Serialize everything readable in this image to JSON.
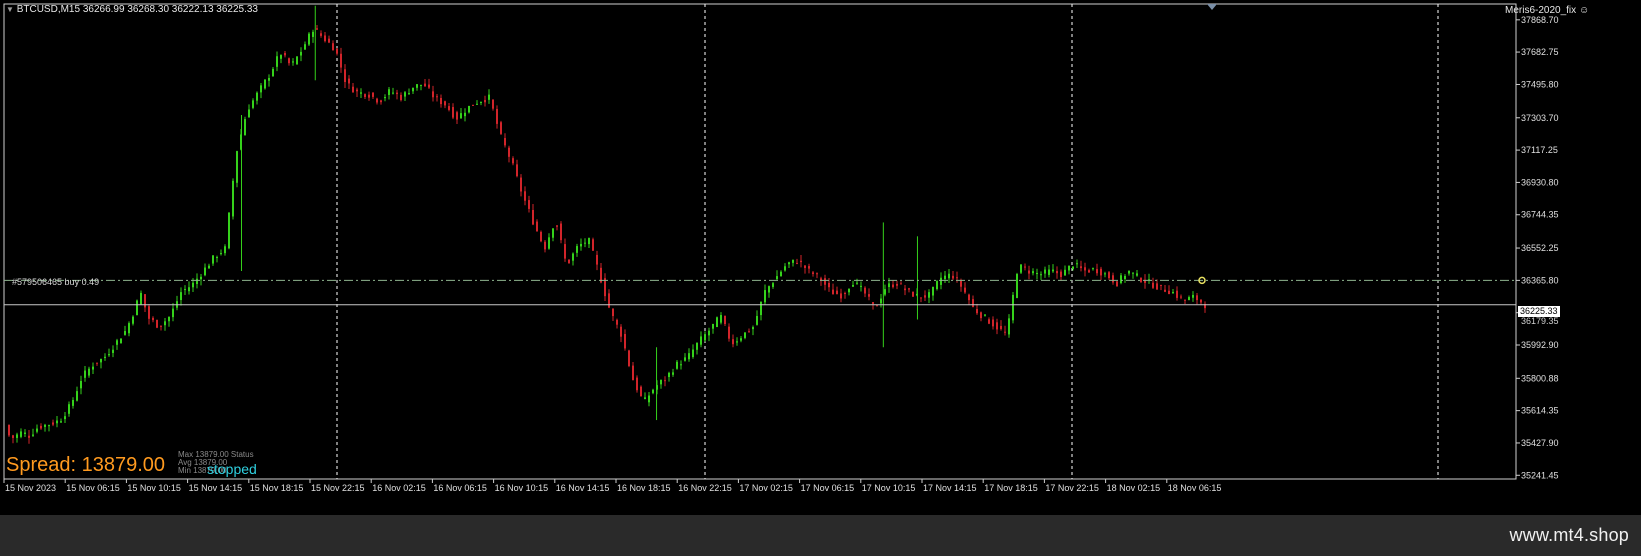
{
  "header": {
    "symbol_info": "BTCUSD,M15  36266.99 36268.30 36222.13 36225.33",
    "indicator_name": "Meris6-2020_fix"
  },
  "chart_data": {
    "type": "candlestick",
    "symbol": "BTCUSD",
    "timeframe": "M15",
    "ohlc": {
      "open": 36266.99,
      "high": 36268.3,
      "low": 36222.13,
      "close": 36225.33
    },
    "y_ticks": [
      "37868.70",
      "37682.75",
      "37495.80",
      "37303.70",
      "37117.25",
      "36930.80",
      "36744.35",
      "36552.25",
      "36365.80",
      "36179.35",
      "35992.90",
      "35800.88",
      "35614.35",
      "35427.90",
      "35241.45"
    ],
    "y_tick_values": [
      37868.7,
      37682.75,
      37495.8,
      37303.7,
      37117.25,
      36930.8,
      36744.35,
      36552.25,
      36365.8,
      36179.35,
      35992.9,
      35800.88,
      35614.35,
      35427.9,
      35241.45
    ],
    "ylim": [
      35220,
      37960
    ],
    "x_ticks": [
      "15 Nov 2023",
      "15 Nov 06:15",
      "15 Nov 10:15",
      "15 Nov 14:15",
      "15 Nov 18:15",
      "15 Nov 22:15",
      "16 Nov 02:15",
      "16 Nov 06:15",
      "16 Nov 10:15",
      "16 Nov 14:15",
      "16 Nov 18:15",
      "16 Nov 22:15",
      "17 Nov 02:15",
      "17 Nov 06:15",
      "17 Nov 10:15",
      "17 Nov 14:15",
      "17 Nov 18:15",
      "17 Nov 22:15",
      "18 Nov 02:15",
      "18 Nov 06:15"
    ],
    "current_price": "36225.33",
    "price_below_tag": "36179.35",
    "order_line": {
      "label": "#579506465 buy 0.49",
      "price": 36365.8
    },
    "path_points": [
      [
        0,
        35530
      ],
      [
        0.5,
        35450
      ],
      [
        1.5,
        35490
      ],
      [
        2.2,
        35470
      ],
      [
        3.0,
        35520
      ],
      [
        4.2,
        35540
      ],
      [
        5.0,
        35560
      ],
      [
        6.0,
        35650
      ],
      [
        7.0,
        35810
      ],
      [
        8.0,
        35880
      ],
      [
        9.0,
        35920
      ],
      [
        10.0,
        36000
      ],
      [
        11.0,
        36080
      ],
      [
        11.8,
        36200
      ],
      [
        12.3,
        36300
      ],
      [
        13.0,
        36150
      ],
      [
        14.0,
        36100
      ],
      [
        15.0,
        36160
      ],
      [
        16.0,
        36300
      ],
      [
        17.0,
        36340
      ],
      [
        18.0,
        36420
      ],
      [
        19.0,
        36500
      ],
      [
        20.0,
        36550
      ],
      [
        21.0,
        37100
      ],
      [
        22.0,
        37350
      ],
      [
        23.0,
        37450
      ],
      [
        24.0,
        37550
      ],
      [
        25.0,
        37680
      ],
      [
        26.0,
        37600
      ],
      [
        27.0,
        37700
      ],
      [
        28.0,
        37820
      ],
      [
        29.0,
        37760
      ],
      [
        30.0,
        37700
      ],
      [
        31.0,
        37500
      ],
      [
        32.0,
        37450
      ],
      [
        33.0,
        37440
      ],
      [
        34.0,
        37400
      ],
      [
        35.0,
        37460
      ],
      [
        36.0,
        37420
      ],
      [
        37.0,
        37480
      ],
      [
        38.0,
        37500
      ],
      [
        39.0,
        37420
      ],
      [
        40.0,
        37380
      ],
      [
        41.0,
        37300
      ],
      [
        42.0,
        37360
      ],
      [
        43.0,
        37400
      ],
      [
        44.0,
        37420
      ],
      [
        45.0,
        37200
      ],
      [
        46.0,
        37050
      ],
      [
        47.0,
        36860
      ],
      [
        48.0,
        36700
      ],
      [
        49.0,
        36550
      ],
      [
        50.0,
        36720
      ],
      [
        51.0,
        36450
      ],
      [
        52.0,
        36560
      ],
      [
        53.0,
        36600
      ],
      [
        54.0,
        36400
      ],
      [
        55.0,
        36180
      ],
      [
        56.0,
        36050
      ],
      [
        57.0,
        35800
      ],
      [
        58.0,
        35660
      ],
      [
        59.0,
        35750
      ],
      [
        60.0,
        35800
      ],
      [
        61.0,
        35880
      ],
      [
        62.0,
        35920
      ],
      [
        63.0,
        36010
      ],
      [
        64.0,
        36080
      ],
      [
        65.0,
        36160
      ],
      [
        66.0,
        36000
      ],
      [
        67.0,
        36050
      ],
      [
        68.0,
        36100
      ],
      [
        69.0,
        36300
      ],
      [
        70.0,
        36380
      ],
      [
        71.0,
        36460
      ],
      [
        72.0,
        36480
      ],
      [
        73.0,
        36420
      ],
      [
        74.0,
        36380
      ],
      [
        75.0,
        36300
      ],
      [
        76.0,
        36280
      ],
      [
        77.0,
        36360
      ],
      [
        78.0,
        36300
      ],
      [
        79.0,
        36200
      ],
      [
        80.0,
        36330
      ],
      [
        81.0,
        36350
      ],
      [
        82.0,
        36300
      ],
      [
        83.0,
        36270
      ],
      [
        84.0,
        36280
      ],
      [
        85.0,
        36380
      ],
      [
        86.0,
        36400
      ],
      [
        87.0,
        36320
      ],
      [
        88.0,
        36200
      ],
      [
        89.0,
        36150
      ],
      [
        90.0,
        36100
      ],
      [
        91.0,
        36050
      ],
      [
        92.0,
        36450
      ],
      [
        93.0,
        36420
      ],
      [
        94.0,
        36400
      ],
      [
        95.0,
        36420
      ],
      [
        96.0,
        36400
      ],
      [
        97.0,
        36460
      ],
      [
        98.0,
        36420
      ],
      [
        99.0,
        36430
      ],
      [
        100.0,
        36400
      ],
      [
        101.0,
        36350
      ],
      [
        102.0,
        36420
      ],
      [
        103.0,
        36380
      ],
      [
        104.0,
        36350
      ],
      [
        105.0,
        36320
      ],
      [
        106.0,
        36300
      ],
      [
        107.0,
        36250
      ],
      [
        108.0,
        36270
      ],
      [
        109.0,
        36225
      ]
    ],
    "spikes": [
      [
        21.3,
        36420,
        37320
      ],
      [
        28.0,
        37520,
        37950
      ],
      [
        59.0,
        35560,
        35980
      ],
      [
        79.6,
        35980,
        36700
      ],
      [
        82.7,
        36140,
        36620
      ]
    ]
  },
  "status": {
    "spread_label": "Spread: 13879.00",
    "small_lines": [
      "Max 13879.00  Status",
      "Avg 13879.00",
      "Min  13879.00"
    ],
    "state": "stopped"
  },
  "footer": {
    "site": "www.mt4.shop"
  },
  "colors": {
    "background": "#000000",
    "bull": "#35d21b",
    "bear": "#d2242a",
    "grid": "#ffffff",
    "order_line": "#8fb48f",
    "price_line": "#c8c8c8",
    "spread": "#ff9a1f",
    "stopped": "#2fd0e0"
  }
}
